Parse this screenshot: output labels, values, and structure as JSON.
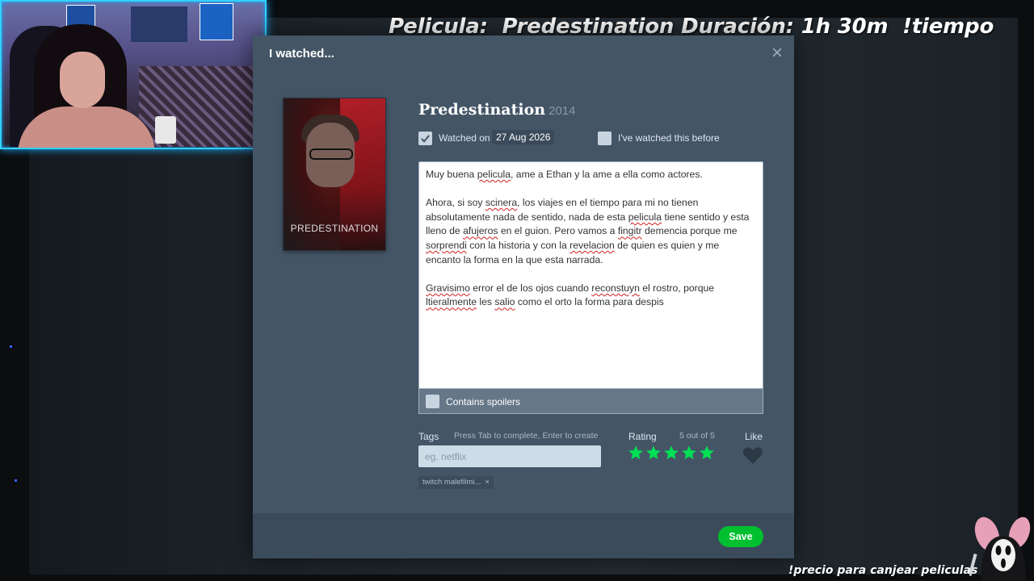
{
  "stream_overlay": {
    "title": "Pelicula:  Predestination Duración: 1h 30m  !tiempo",
    "bottom_text": "!precio para canjear peliculas"
  },
  "modal": {
    "title": "I watched...",
    "close_label": "×",
    "poster_title": "PREDESTINATION",
    "film_title": "Predestination",
    "film_year": "2014",
    "watched_on_label": "Watched on",
    "watched_on_checked": true,
    "watched_date": "27 Aug 2026",
    "watched_before_label": "I've watched this before",
    "watched_before_checked": false,
    "review": {
      "p1": "Muy buena pelicula, ame a Ethan y la ame a ella como actores.",
      "p2": "Ahora, si soy scinera, los viajes en el tiempo para mi no tienen absolutamente nada de sentido, nada de esta pelicula tiene sentido y esta lleno de afujeros en el guion. Pero vamos a fingitr demencia porque me sorprendi con la historia y con la revelacion de quien es quien y me encanto la forma en la que esta narrada.",
      "p3": "Gravisimo error el de los ojos cuando reconstuyn el rostro, porque ltieralmente les salio como el orto la forma para despis"
    },
    "spoilers_label": "Contains spoilers",
    "spoilers_checked": false,
    "tags_label": "Tags",
    "tags_hint": "Press Tab to complete, Enter to create",
    "tags_placeholder": "eg. netflix",
    "tags": [
      "twitch malefilmi..."
    ],
    "rating_label": "Rating",
    "rating_text": "5 out of 5",
    "rating_value": 5,
    "rating_max": 5,
    "like_label": "Like",
    "liked": false,
    "save_label": "Save"
  },
  "colors": {
    "modal_bg": "#445566",
    "star": "#00e054",
    "save": "#00c030"
  }
}
